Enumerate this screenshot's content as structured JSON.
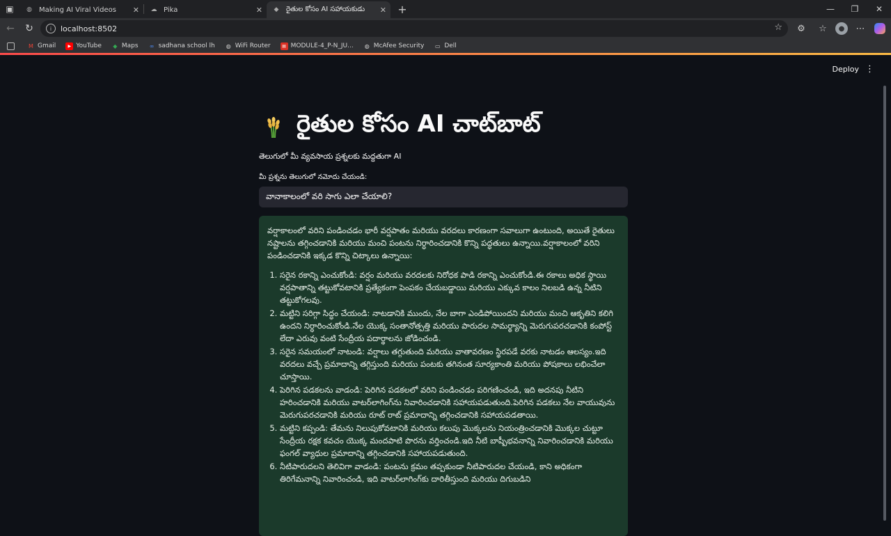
{
  "browser": {
    "tabs": [
      {
        "title": "Making AI Viral Videos",
        "active": false
      },
      {
        "title": "Pika",
        "active": false
      },
      {
        "title": "రైతుల కోసం AI సహాయకుడు",
        "active": true
      }
    ],
    "url": "localhost:8502",
    "bookmarks": [
      "Gmail",
      "YouTube",
      "Maps",
      "sadhana school lh",
      "WiFi Router",
      "MODULE-4_P-N_JU...",
      "McAfee Security",
      "Dell"
    ]
  },
  "app": {
    "deploy_label": "Deploy",
    "title": "రైతుల కోసం AI చాట్‌బాట్",
    "subtitle": "తెలుగులో మీ వ్యవసాయ ప్రశ్నలకు మద్దతుగా AI",
    "input_label": "మీ ప్రశ్నను తెలుగులో నమోదు చేయండి:",
    "input_value": "వానాకాలంలో వరి సాగు ఎలా చేయాలి?",
    "answer_intro": "వర్షాకాలంలో వరిని పండించడం భారీ వర్షపాతం మరియు వరదలు కారణంగా సవాలుగా ఉంటుంది, అయితే రైతులు నష్టాలను తగ్గించడానికి మరియు మంచి పంటను నిర్ధారించడానికి కొన్ని పద్ధతులు ఉన్నాయి.వర్షాకాలంలో వరిని పండించడానికి ఇక్కడ కొన్ని చిట్కాలు ఉన్నాయి:",
    "answer_points": [
      "సరైన రకాన్ని ఎంచుకోండి: వర్షం మరియు వరదలకు నిరోధక పాడి రకాన్ని ఎంచుకోండి.ఈ రకాలు అధిక స్థాయి వర్షపాతాన్ని తట్టుకోవటానికి ప్రత్యేకంగా పెంపకం చేయబడ్డాయి మరియు ఎక్కువ కాలం నిలబడి ఉన్న నీటిని తట్టుకోగలవు.",
      "మట్టిని సరిగ్గా సిద్ధం చేయండి: నాటడానికి ముందు, నేల బాగా ఎండిపోయిందని మరియు మంచి ఆకృతిని కలిగి ఉందని నిర్ధారించుకోండి.నేల యొక్క సంతానోత్పత్తి మరియు పారుదల సామర్థ్యాన్ని మెరుగుపరచడానికి కంపోస్ట్ లేదా ఎరువు వంటి సేంద్రీయ పదార్థాలను జోడించండి.",
      "సరైన సమయంలో నాటండి: వర్షాలు తగ్గుతుంది మరియు వాతావరణం స్థిరపడే వరకు నాటడం ఆలస్యం.ఇది వరదలు వచ్చే ప్రమాదాన్ని తగ్గిస్తుంది మరియు పంటకు తగినంత సూర్యకాంతి మరియు పోషకాలు లభించేలా చూస్తాయి.",
      "పెరిగిన పడకలను వాడండి: పెరిగిన పడకలలో వరిని పండించడం పరిగణించండి, ఇది అదనపు నీటిని హరించడానికి మరియు వాటర్‌లాగింగ్‌ను నివారించడానికి సహాయపడుతుంది.పెరిగిన పడకలు నేల వాయువును మెరుగుపరచడానికి మరియు రూట్ రాట్ ప్రమాదాన్ని తగ్గించడానికి సహాయపడతాయి.",
      "మట్టిని కప్పండి: తేమను నిలుపుకోవటానికి మరియు కలుపు మొక్కలను నియంత్రించడానికి మొక్కల చుట్టూ సేంద్రీయ రక్షక కవచం యొక్క మందపాటి పొరను వర్తించండి.ఇది నీటి బాష్పీభవనాన్ని నివారించడానికి మరియు ఫంగల్ వ్యాధుల ప్రమాదాన్ని తగ్గించడానికి సహాయపడుతుంది.",
      "నీటిపారుదలని తెలివిగా వాడండి: పంటను క్రమం తప్పకుండా నీటిపారుదల చేయండి, కాని అధికంగా తిరిగేమనాన్ని నివారించండి, ఇది వాటర్‌లాగింగ్‌కు దారితీస్తుంది మరియు దిగుబడిని"
    ]
  }
}
